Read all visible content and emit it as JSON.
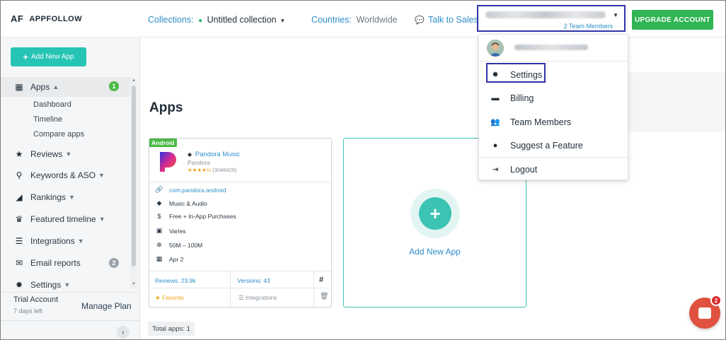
{
  "brand": {
    "mark": "AF",
    "name": "APPFOLLOW"
  },
  "sidebar": {
    "add_app_label": "Add New App",
    "apps": {
      "label": "Apps",
      "badge": "1",
      "subitems": [
        "Dashboard",
        "Timeline",
        "Compare apps"
      ]
    },
    "items": [
      {
        "label": "Reviews"
      },
      {
        "label": "Keywords & ASO"
      },
      {
        "label": "Rankings"
      },
      {
        "label": "Featured timeline"
      },
      {
        "label": "Integrations"
      },
      {
        "label": "Email reports",
        "badge": "2"
      },
      {
        "label": "Settings"
      }
    ],
    "trial": {
      "title": "Trial Account",
      "days": "7 days left",
      "manage": "Manage Plan"
    }
  },
  "topbar": {
    "collections_label": "Collections:",
    "collections_value": "Untitled collection",
    "countries_label": "Countries:",
    "countries_value": "Worldwide",
    "talk_label": "Talk to Sales",
    "team_members": "2 Team Members",
    "upgrade_label": "UPGRADE ACCOUNT"
  },
  "main": {
    "title": "Apps",
    "app_card": {
      "platform": "Android",
      "name": "Pandora Music",
      "publisher": "Pandora",
      "stars": "★★★★½",
      "rating_count": "(3046429)",
      "package": "com.pandora.android",
      "category": "Music & Audio",
      "price": "Free + In-App Purchases",
      "size": "Varies",
      "installs": "50M – 100M",
      "date": "Apr 2",
      "reviews": "Reviews: 23.9k",
      "versions": "Versions: 43",
      "favorite": "Favorite",
      "integrations": "Integrations"
    },
    "add_card_label": "Add New App",
    "total_apps": "Total apps:  1"
  },
  "dropdown": {
    "items": [
      "Settings",
      "Billing",
      "Team Members",
      "Suggest a Feature",
      "Logout"
    ]
  },
  "chat": {
    "count": "2"
  },
  "colors": {
    "accent": "#25c4b4",
    "upgrade": "#30b454",
    "link": "#2f8fc9",
    "highlight": "#2f32a8"
  }
}
